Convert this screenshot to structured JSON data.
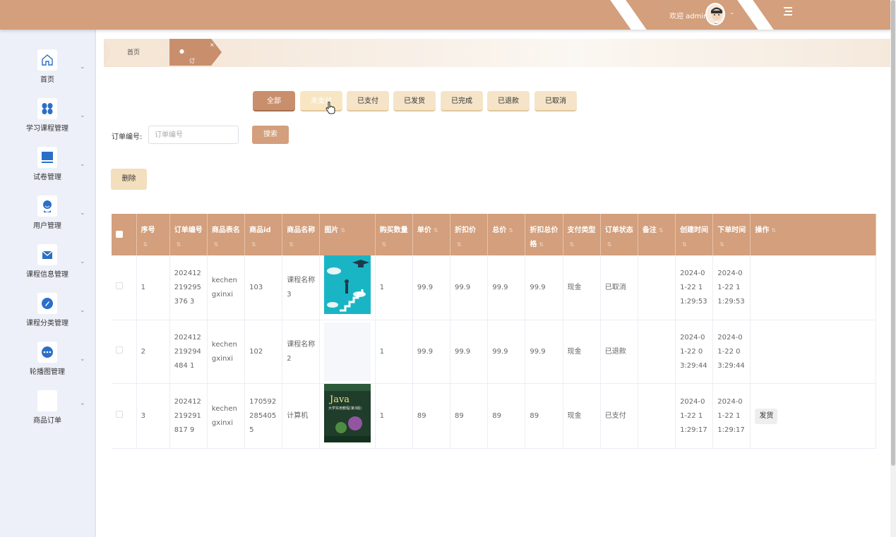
{
  "header": {
    "welcome": "欢迎 admin"
  },
  "sidebar": {
    "items": [
      {
        "label": "首页",
        "icon": "home-icon"
      },
      {
        "label": "学习课程管理",
        "icon": "grid-icon"
      },
      {
        "label": "试卷管理",
        "icon": "monitor-icon"
      },
      {
        "label": "用户管理",
        "icon": "user-icon"
      },
      {
        "label": "课程信息管理",
        "icon": "envelope-icon"
      },
      {
        "label": "课程分类管理",
        "icon": "compass-icon"
      },
      {
        "label": "轮播图管理",
        "icon": "dots-icon"
      },
      {
        "label": "商品订单",
        "icon": "order-icon"
      }
    ]
  },
  "breadcrumb": {
    "home": "首页",
    "current": "订单管理",
    "close": "×"
  },
  "status_filters": [
    "全部",
    "未支付",
    "已支付",
    "已发货",
    "已完成",
    "已退款",
    "已取消"
  ],
  "search": {
    "label": "订单编号:",
    "placeholder": "订单编号",
    "button": "搜索"
  },
  "actions": {
    "delete": "删除"
  },
  "table": {
    "headers": [
      "序号",
      "订单编号",
      "商品表名",
      "商品id",
      "商品名称",
      "图片",
      "购买数量",
      "单价",
      "折扣价",
      "总价",
      "折扣总价格",
      "支付类型",
      "订单状态",
      "备注",
      "创建时间",
      "下单时间",
      "操作"
    ],
    "rows": [
      {
        "index": "1",
        "order_no": "202412219295376 3",
        "table_name": "kechengxinxi",
        "goods_id": "103",
        "goods_name": "课程名称3",
        "quantity": "1",
        "price": "99.9",
        "discount_price": "99.9",
        "total": "99.9",
        "discount_total": "99.9",
        "pay_type": "现金",
        "status": "已取消",
        "remark": "",
        "created": "2024-01-22 11:29:53",
        "ordered": "2024-01-22 11:29:53",
        "action": ""
      },
      {
        "index": "2",
        "order_no": "202412219294484 1",
        "table_name": "kechengxinxi",
        "goods_id": "102",
        "goods_name": "课程名称2",
        "quantity": "1",
        "price": "99.9",
        "discount_price": "99.9",
        "total": "99.9",
        "discount_total": "99.9",
        "pay_type": "现金",
        "status": "已退款",
        "remark": "",
        "created": "2024-01-22 03:29:44",
        "ordered": "2024-01-22 03:29:44",
        "action": ""
      },
      {
        "index": "3",
        "order_no": "202412219291817 9",
        "table_name": "kechengxinxi",
        "goods_id": "1705922854055",
        "goods_name": "计算机",
        "quantity": "1",
        "price": "89",
        "discount_price": "89",
        "total": "89",
        "discount_total": "89",
        "pay_type": "现金",
        "status": "已支付",
        "remark": "",
        "created": "2024-01-22 11:29:17",
        "ordered": "2024-01-22 11:29:17",
        "action": "发货"
      }
    ]
  },
  "images": {
    "book_title": "Java",
    "book_subtitle": "大学实用教程(第3版)"
  },
  "colors": {
    "brand": "#d39f7c",
    "active_tab": "#c98f6d",
    "sidebar_bg": "#edf0f8",
    "icon_blue": "#2b6fc7"
  }
}
